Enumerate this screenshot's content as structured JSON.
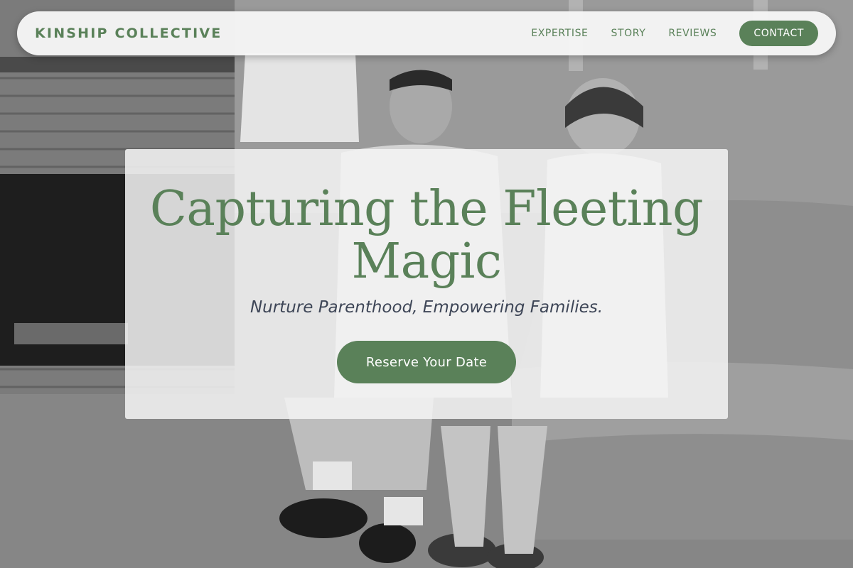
{
  "brand": {
    "name": "KINSHIP COLLECTIVE"
  },
  "nav": {
    "links": [
      {
        "label": "EXPERTISE"
      },
      {
        "label": "STORY"
      },
      {
        "label": "REVIEWS"
      }
    ],
    "cta_label": "CONTACT"
  },
  "hero": {
    "title": "Capturing the Fleeting Magic",
    "subtitle": "Nurture Parenthood, Empowering Families.",
    "cta_label": "Reserve Your Date"
  },
  "colors": {
    "accent": "#5a8159",
    "subtitle_text": "#3e4657",
    "card_background": "#f5f5f5"
  },
  "background": {
    "icon": "family-vintage-photo"
  }
}
